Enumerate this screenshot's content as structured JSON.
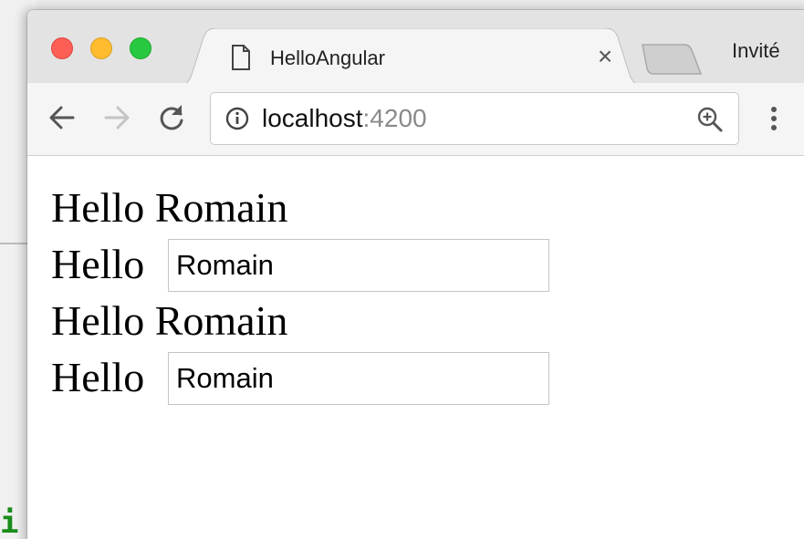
{
  "background": {
    "code_fragment": "i"
  },
  "browser": {
    "tab": {
      "title": "HelloAngular",
      "close_label": "×",
      "favicon": "page-icon"
    },
    "profile_label": "Invité",
    "toolbar": {
      "back_icon": "back-arrow-icon",
      "forward_icon": "forward-arrow-icon",
      "reload_icon": "reload-icon",
      "url_host": "localhost",
      "url_port": ":4200",
      "zoom_icon": "zoom-in-icon",
      "menu_icon": "vertical-dots-icon"
    }
  },
  "page": {
    "lines": [
      {
        "prefix": "Hello",
        "name": "Romain"
      },
      {
        "prefix": "Hello",
        "input_value": "Romain"
      },
      {
        "prefix": "Hello",
        "name": "Romain"
      },
      {
        "prefix": "Hello",
        "input_value": "Romain"
      }
    ]
  },
  "colors": {
    "traffic_red": "#fd5f57",
    "traffic_yellow": "#febc2e",
    "traffic_green": "#28c840",
    "url_port": "#8a8a8a",
    "code_green": "#1a8c1a"
  }
}
